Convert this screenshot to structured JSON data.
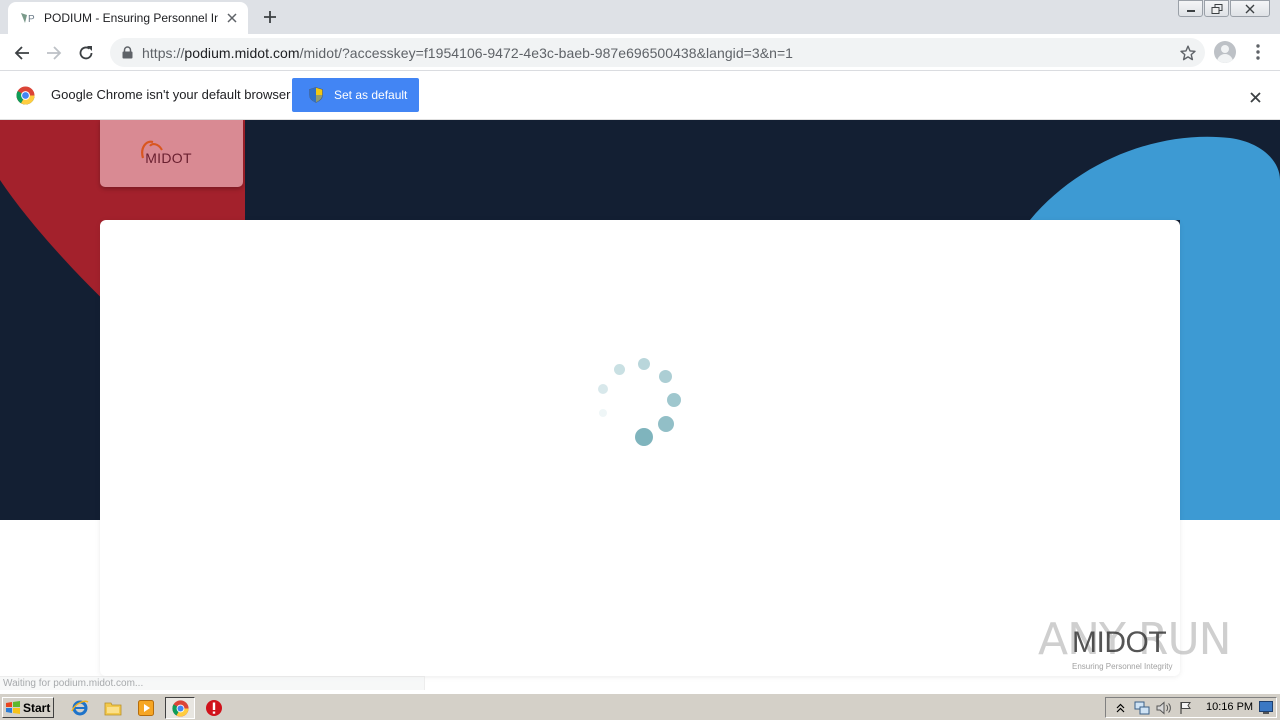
{
  "browser": {
    "tab": {
      "title": "PODIUM - Ensuring Personnel Integr",
      "favicon": "podium-favicon"
    },
    "url": {
      "scheme": "https://",
      "host": "podium.midot.com",
      "path": "/midot/?accesskey=f1954106-9472-4e3c-baeb-987e696500438&langid=3&n=1"
    },
    "infobar": {
      "message": "Google Chrome isn't your default browser",
      "button_label": "Set as default"
    },
    "status_text": "Waiting for podium.midot.com..."
  },
  "page": {
    "logo_text": "MIDOT",
    "loading": true,
    "watermark": {
      "text": "ANY RUN",
      "logo": "MIDOT",
      "tagline": "Ensuring Personnel Integrity"
    }
  },
  "taskbar": {
    "start_label": "Start",
    "clock": "10:16 PM"
  },
  "colors": {
    "hero_bg": "#131f33",
    "accent_red": "#a3212c",
    "accent_blue": "#3d9ad3",
    "spinner": "#7fb4bd",
    "chrome_button": "#4285f4"
  }
}
